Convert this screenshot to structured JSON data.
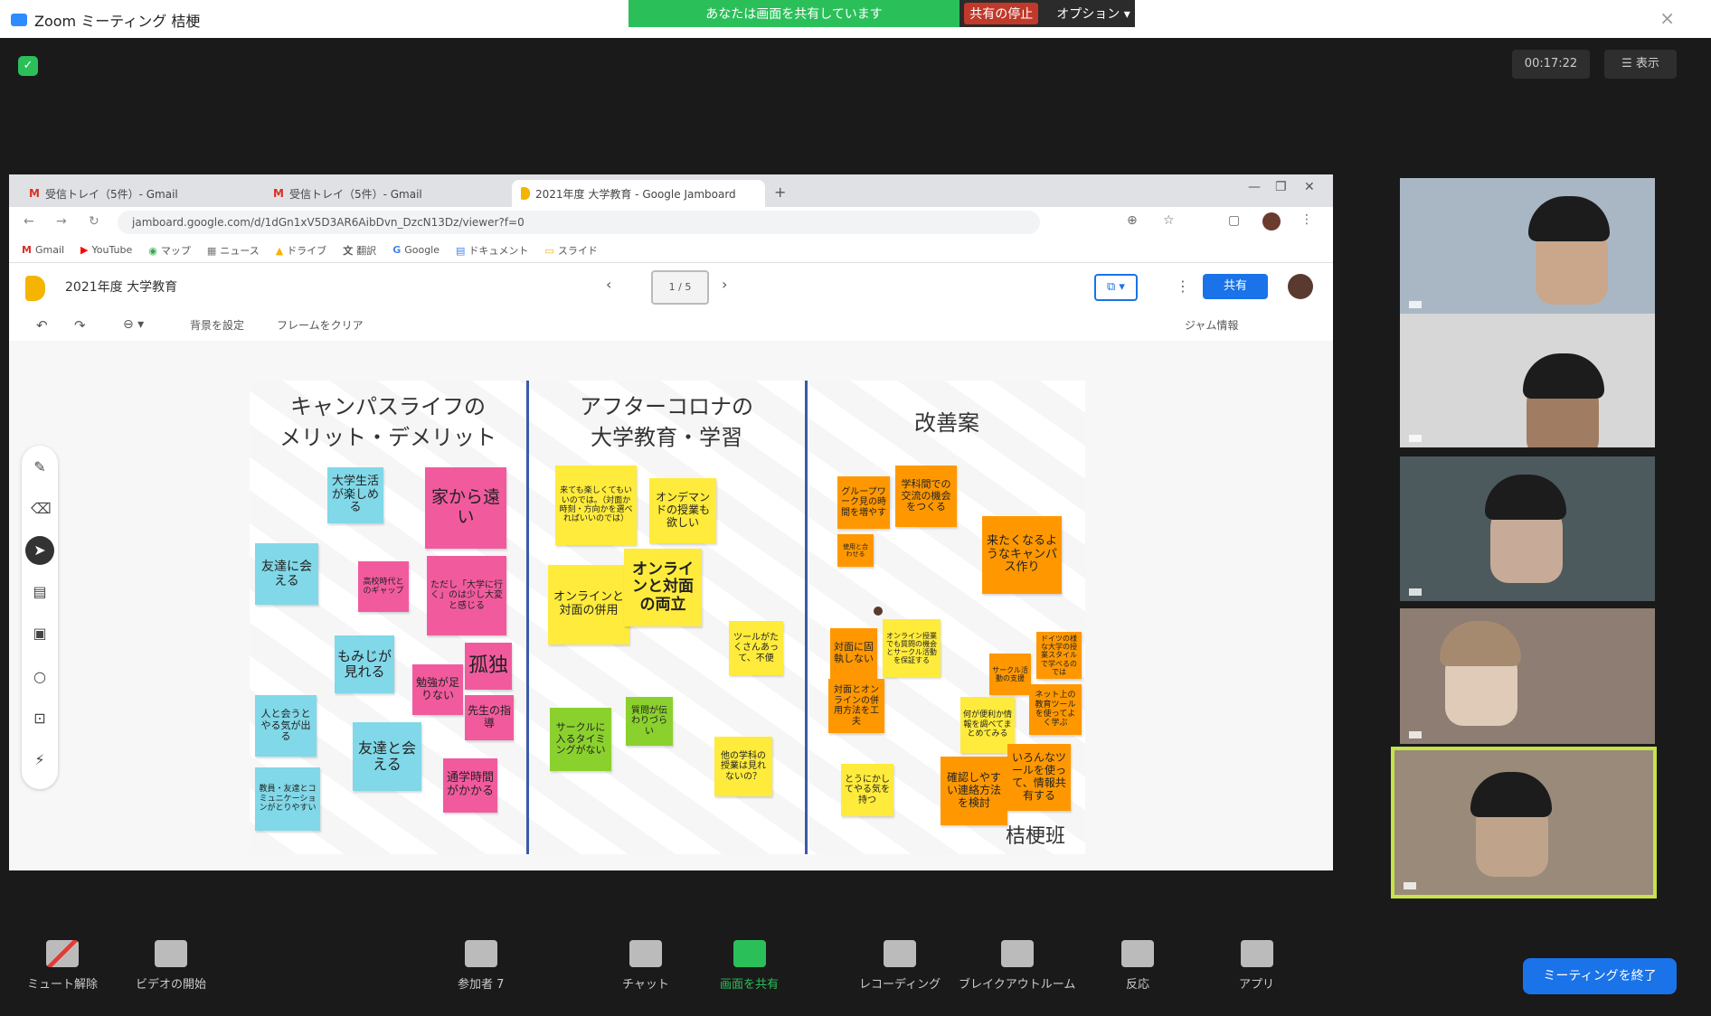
{
  "window": {
    "app_title": "Zoom ミーティング 桔梗",
    "close_icon": "×"
  },
  "banner": {
    "sharing_text": "あなたは画面を共有しています",
    "stop_text": "共有の停止",
    "options_text": "オプション ▾"
  },
  "zoom_top": {
    "timer": "00:17:22",
    "view_label": "☰ 表示"
  },
  "browser": {
    "tabs": [
      {
        "label": "受信トレイ（5件）- Gmail",
        "icon": "gmail-icon"
      },
      {
        "label": "受信トレイ（5件）- Gmail",
        "icon": "gmail-icon"
      },
      {
        "label": "2021年度 大学教育 - Google Jamboard",
        "icon": "jamboard-icon"
      }
    ],
    "url": "jamboard.google.com/d/1dGn1xV5D3AR6AibDvn_DzcN13Dz/viewer?f=0",
    "bookmarks": [
      "Gmail",
      "YouTube",
      "マップ",
      "ニュース",
      "ドライブ",
      "翻訳",
      "Google",
      "ドキュメント",
      "スライド"
    ]
  },
  "jamboard": {
    "doc_title": "2021年度 大学教育",
    "frame_indicator": "1 / 5",
    "share_label": "共有",
    "cast_label": "⧉ ▾",
    "toolbar": {
      "set_bg": "背景を設定",
      "clear_frame": "フレームをクリア",
      "jam_info": "ジャム情報"
    },
    "columns": [
      {
        "title": "キャンパスライフの\nメリット・デメリット"
      },
      {
        "title": "アフターコロナの\n大学教育・学習"
      },
      {
        "title": "改善案"
      }
    ],
    "signature": "桔梗班",
    "notes": [
      {
        "text": "大学生活が楽しめる",
        "color": "blue"
      },
      {
        "text": "家から遠い",
        "color": "pink"
      },
      {
        "text": "友達に会える",
        "color": "blue"
      },
      {
        "text": "高校時代とのギャップ",
        "color": "pink"
      },
      {
        "text": "ただし「大学に行く」のは少し大変と感じる",
        "color": "pink"
      },
      {
        "text": "もみじが見れる",
        "color": "blue"
      },
      {
        "text": "孤独",
        "color": "pink"
      },
      {
        "text": "勉強が足りない",
        "color": "pink"
      },
      {
        "text": "人と会うとやる気が出る",
        "color": "blue"
      },
      {
        "text": "先生の指導",
        "color": "pink"
      },
      {
        "text": "友達と会える",
        "color": "blue"
      },
      {
        "text": "通学時間がかかる",
        "color": "pink"
      },
      {
        "text": "教員・友達とコミュニケーションがとりやすい",
        "color": "blue"
      },
      {
        "text": "来ても楽しくてもいいのでは。（対面か時刻・方向かを選べればいいのでは）",
        "color": "yellow"
      },
      {
        "text": "オンデマンドの授業も欲しい",
        "color": "yellow"
      },
      {
        "text": "オンラインと対面の併用",
        "color": "yellow"
      },
      {
        "text": "オンラインと対面の両立",
        "color": "yellow"
      },
      {
        "text": "ツールがたくさんあって、不便",
        "color": "yellow"
      },
      {
        "text": "サークルに入るタイミングがない",
        "color": "green"
      },
      {
        "text": "質問が伝わりづらい",
        "color": "green"
      },
      {
        "text": "他の学科の授業は見れないの？",
        "color": "yellow"
      },
      {
        "text": "グループワーク見の時間を増やす",
        "color": "orange"
      },
      {
        "text": "学科間での交流の機会をつくる",
        "color": "orange"
      },
      {
        "text": "来たくなるようなキャンパス作り",
        "color": "orange"
      },
      {
        "text": "使用と合わせる",
        "color": "orange"
      },
      {
        "text": "対面に固執しない",
        "color": "orange"
      },
      {
        "text": "オンライン授業でも質問の機会とサークル活動を保証する",
        "color": "yellow"
      },
      {
        "text": "サークル活動の支援",
        "color": "orange"
      },
      {
        "text": "ドイツの様な大学の授業スタイルで学べるのでは",
        "color": "orange"
      },
      {
        "text": "対面とオンラインの併用方法を工夫",
        "color": "orange"
      },
      {
        "text": "何が便利か情報を調べてまとめてみる",
        "color": "yellow"
      },
      {
        "text": "ネット上の教育ツールを使ってよく学ぶ",
        "color": "orange"
      },
      {
        "text": "とうにかしてやる気を持つ",
        "color": "yellow"
      },
      {
        "text": "確認しやすい連絡方法を検討",
        "color": "orange"
      },
      {
        "text": "いろんなツールを使って、情報共有する",
        "color": "orange"
      }
    ]
  },
  "bottom_bar": {
    "mute": "ミュート解除",
    "video": "ビデオの開始",
    "participants": "参加者",
    "participants_count": "7",
    "chat": "チャット",
    "share": "画面を共有",
    "record": "レコーディング",
    "breakout": "ブレイクアウトルーム",
    "reactions": "反応",
    "apps": "アプリ",
    "end": "ミーティングを終了"
  },
  "colors": {
    "share_green": "#2bbf5a",
    "zoom_blue": "#1a73e8",
    "pink": "#f15b9e",
    "blue": "#81d8e8",
    "yellow": "#ffeb3b",
    "green": "#8bd12d",
    "orange": "#ff9800"
  }
}
